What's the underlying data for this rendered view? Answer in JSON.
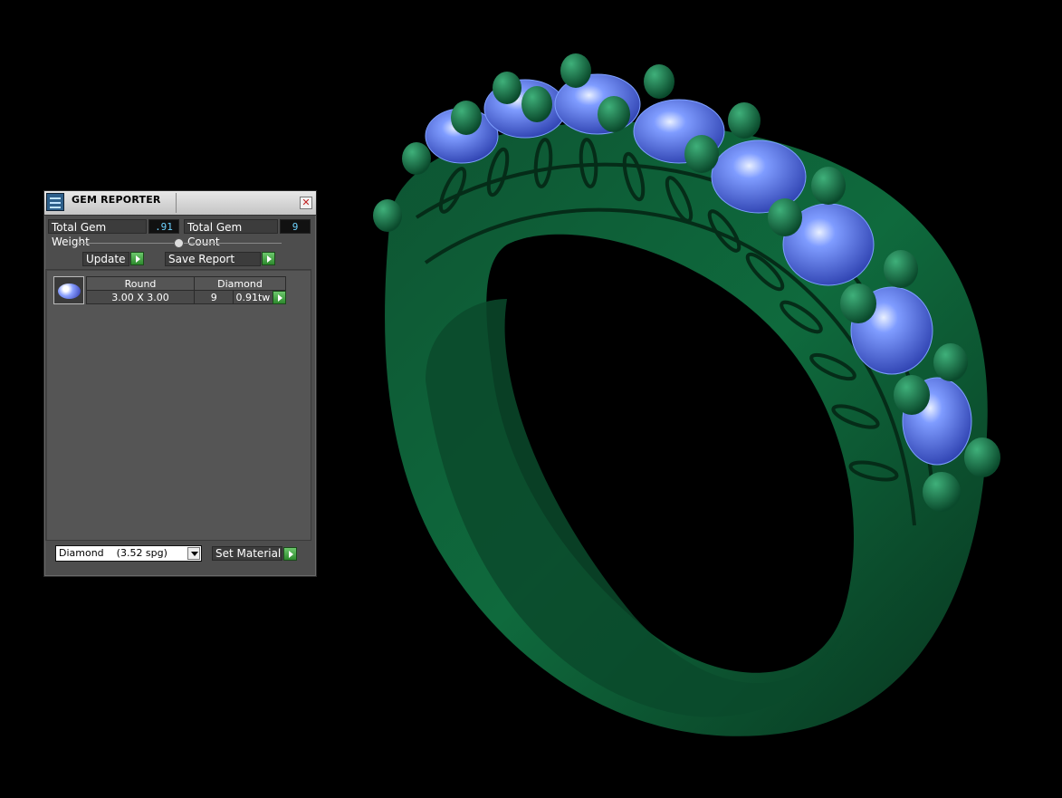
{
  "window": {
    "title": "GEM REPORTER",
    "close_glyph": "✕"
  },
  "totals": {
    "weight_label": "Total Gem Weight",
    "weight_value": ".91",
    "count_label": "Total Gem Count",
    "count_value": "9"
  },
  "actions": {
    "update_label": "Update",
    "save_report_label": "Save Report",
    "set_material_label": "Set Material"
  },
  "gem_list": {
    "headers": [
      "Round",
      "Diamond"
    ],
    "rows": [
      {
        "size": "3.00 X 3.00",
        "count": "9",
        "weight": "0.91tw",
        "icon": "round-gem-icon"
      }
    ]
  },
  "material": {
    "selected": "Diamond    (3.52 spg)"
  },
  "colors": {
    "metal": "#0e5a36",
    "gem": "#4a6fd8",
    "value_text": "#6fd3ff",
    "go_button": "#3a9a3a"
  }
}
